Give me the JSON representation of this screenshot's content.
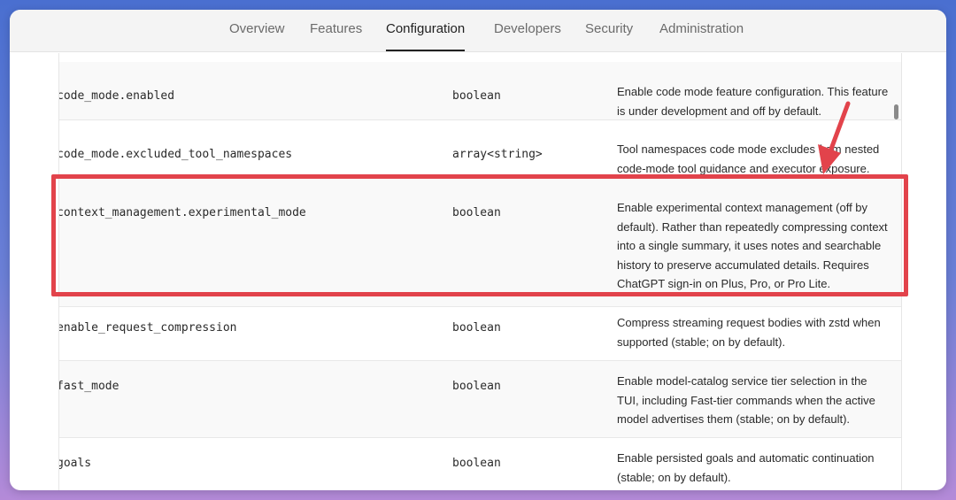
{
  "nav": {
    "tabs": [
      {
        "label": "Overview",
        "active": false
      },
      {
        "label": "Features",
        "active": false
      },
      {
        "label": "Configuration",
        "active": true
      },
      {
        "label": "Developers",
        "active": false
      },
      {
        "label": "Security",
        "active": false
      },
      {
        "label": "Administration",
        "active": false
      }
    ]
  },
  "table": {
    "rows": [
      {
        "key": "code_mode.enabled",
        "type": "boolean",
        "desc": [
          "Enable code mode feature configuration. This feature",
          "is under development and off by default."
        ]
      },
      {
        "key": "code_mode.excluded_tool_namespaces",
        "type": "array<string>",
        "desc": [
          "Tool namespaces code mode excludes from nested",
          "code-mode tool guidance and executor exposure."
        ]
      },
      {
        "key": "context_management.experimental_mode",
        "type": "boolean",
        "desc": [
          "Enable experimental context management (off by",
          "default). Rather than repeatedly compressing context",
          "into a single summary, it uses notes and searchable",
          "history to preserve accumulated details. Requires",
          "ChatGPT sign-in on Plus, Pro, or Pro Lite."
        ]
      },
      {
        "key": "enable_request_compression",
        "type": "boolean",
        "desc": [
          "Compress streaming request bodies with zstd when",
          "supported (stable; on by default)."
        ]
      },
      {
        "key": "fast_mode",
        "type": "boolean",
        "desc": [
          "Enable model-catalog service tier selection in the",
          "TUI, including Fast-tier commands when the active",
          "model advertises them (stable; on by default)."
        ]
      },
      {
        "key": "goals",
        "type": "boolean",
        "desc": [
          "Enable persisted goals and automatic continuation",
          "(stable; on by default)."
        ]
      }
    ]
  },
  "annotation": {
    "highlight_color": "#e2434b",
    "arrow_color": "#e2434b"
  }
}
